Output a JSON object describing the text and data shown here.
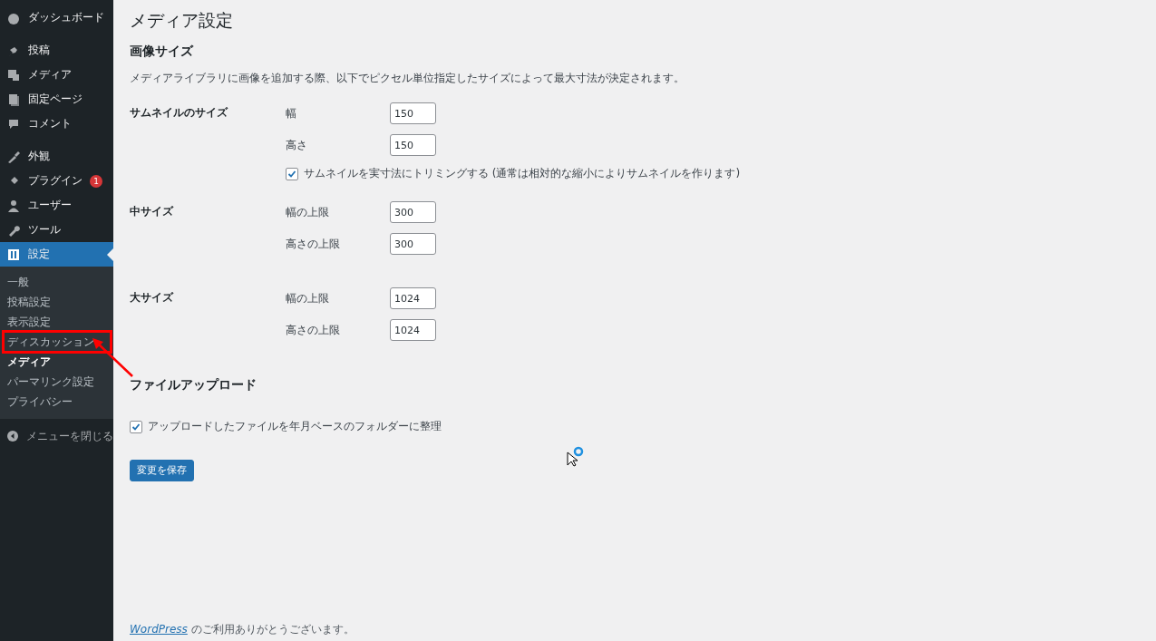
{
  "sidebar": {
    "menu_groups": [
      [
        {
          "label": "ダッシュボード",
          "selected": false
        }
      ],
      [
        {
          "label": "投稿",
          "selected": false
        },
        {
          "label": "メディア",
          "selected": false
        },
        {
          "label": "固定ページ",
          "selected": false
        },
        {
          "label": "コメント",
          "selected": false
        }
      ],
      [
        {
          "label": "外観",
          "selected": false
        },
        {
          "label": "プラグイン",
          "selected": false,
          "badge": "1"
        },
        {
          "label": "ユーザー",
          "selected": false
        },
        {
          "label": "ツール",
          "selected": false
        },
        {
          "label": "設定",
          "selected": true
        }
      ]
    ],
    "submenu": [
      {
        "label": "一般",
        "selected": false,
        "annotated": false
      },
      {
        "label": "投稿設定",
        "selected": false,
        "annotated": false
      },
      {
        "label": "表示設定",
        "selected": false,
        "annotated": false
      },
      {
        "label": "ディスカッション",
        "selected": false,
        "annotated": true
      },
      {
        "label": "メディア",
        "selected": true,
        "annotated": false
      },
      {
        "label": "パーマリンク設定",
        "selected": false,
        "annotated": false
      },
      {
        "label": "プライバシー",
        "selected": false,
        "annotated": false
      }
    ],
    "collapse": "メニューを閉じる"
  },
  "page": {
    "title": "メディア設定",
    "image_sizes": {
      "heading": "画像サイズ",
      "description": "メディアライブラリに画像を追加する際、以下でピクセル単位指定したサイズによって最大寸法が決定されます。",
      "groups": [
        {
          "title": "サムネイルのサイズ",
          "fields": [
            {
              "label": "幅",
              "value": "150"
            },
            {
              "label": "高さ",
              "value": "150"
            }
          ],
          "checkbox": {
            "label": "サムネイルを実寸法にトリミングする (通常は相対的な縮小によりサムネイルを作ります)",
            "checked": true
          }
        },
        {
          "title": "中サイズ",
          "fields": [
            {
              "label": "幅の上限",
              "value": "300"
            },
            {
              "label": "高さの上限",
              "value": "300"
            }
          ]
        },
        {
          "title": "大サイズ",
          "fields": [
            {
              "label": "幅の上限",
              "value": "1024"
            },
            {
              "label": "高さの上限",
              "value": "1024"
            }
          ]
        }
      ]
    },
    "upload": {
      "heading": "ファイルアップロード",
      "checkbox": {
        "label": "アップロードしたファイルを年月ベースのフォルダーに整理",
        "checked": true
      }
    },
    "save_button": "変更を保存"
  },
  "footer": {
    "link": "WordPress",
    "text": "のご利用ありがとうございます。"
  }
}
